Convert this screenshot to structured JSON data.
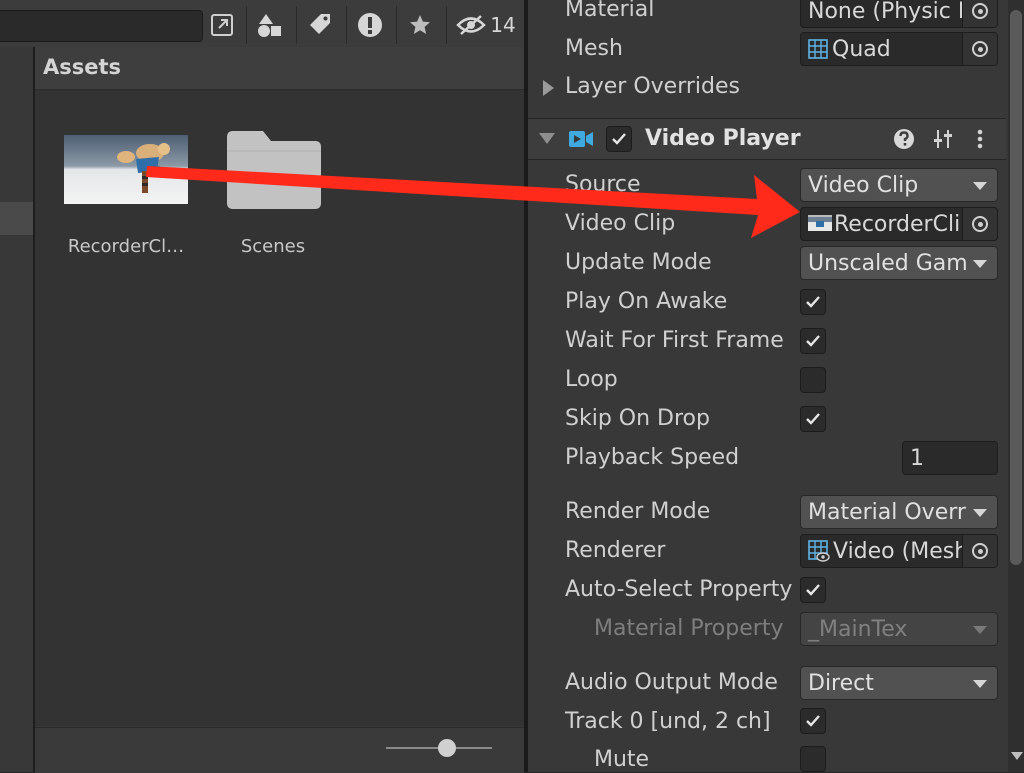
{
  "project": {
    "toolbar": {
      "hidden_count": "14"
    },
    "assets_title": "Assets",
    "items": [
      {
        "label": "RecorderCl…",
        "icon": "video-clip-thumbnail"
      },
      {
        "label": "Scenes",
        "icon": "folder-icon"
      }
    ]
  },
  "inspector": {
    "material": {
      "label": "Material",
      "value": "None (Physic M"
    },
    "mesh": {
      "label": "Mesh",
      "value": "Quad"
    },
    "layer_overrides": "Layer Overrides",
    "component_title": "Video Player",
    "source": {
      "label": "Source",
      "value": "Video Clip"
    },
    "video_clip": {
      "label": "Video Clip",
      "value": "RecorderClip"
    },
    "update_mode": {
      "label": "Update Mode",
      "value": "Unscaled Game"
    },
    "play_on_awake": {
      "label": "Play On Awake",
      "checked": true
    },
    "wait_first_frame": {
      "label": "Wait For First Frame",
      "checked": true
    },
    "loop": {
      "label": "Loop",
      "checked": false
    },
    "skip_on_drop": {
      "label": "Skip On Drop",
      "checked": true
    },
    "playback_speed": {
      "label": "Playback Speed",
      "value": "1"
    },
    "render_mode": {
      "label": "Render Mode",
      "value": "Material Override"
    },
    "renderer": {
      "label": "Renderer",
      "value": "Video (Mesh"
    },
    "auto_select": {
      "label": "Auto-Select Property",
      "checked": true
    },
    "material_property": {
      "label": "Material Property",
      "value": "_MainTex"
    },
    "audio_output": {
      "label": "Audio Output Mode",
      "value": "Direct"
    },
    "track0": {
      "label": "Track 0 [und, 2 ch]",
      "checked": true
    },
    "mute": {
      "label": "Mute",
      "checked": false
    }
  },
  "colors": {
    "annotation_arrow": "#ff2a1a",
    "video_icon": "#3fa9e0"
  }
}
